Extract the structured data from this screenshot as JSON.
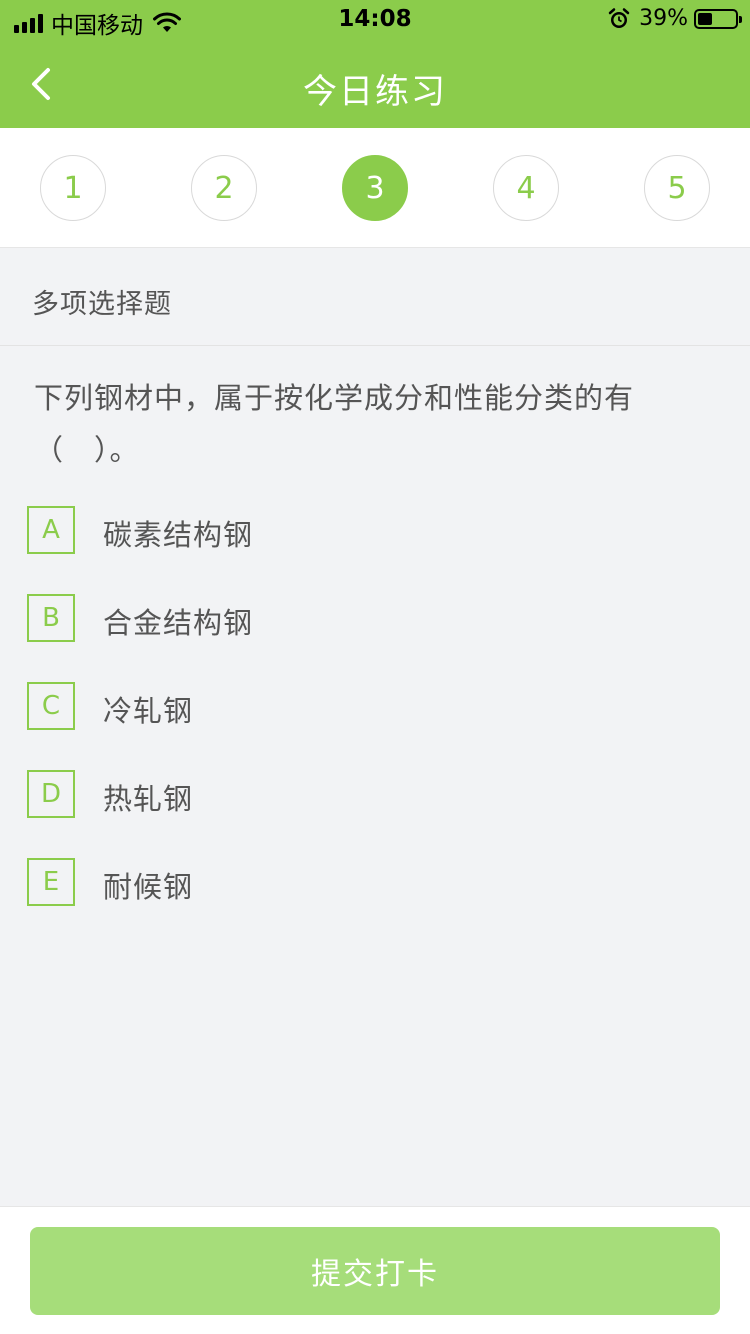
{
  "status_bar": {
    "carrier": "中国移动",
    "time": "14:08",
    "battery_percent": "39%",
    "battery_level": 0.39,
    "icons": [
      "signal-icon",
      "wifi-icon",
      "alarm-icon",
      "battery-icon"
    ]
  },
  "nav": {
    "title": "今日练习",
    "back_icon": "chevron-left-icon"
  },
  "steps": {
    "items": [
      "1",
      "2",
      "3",
      "4",
      "5"
    ],
    "active_index": 2
  },
  "question": {
    "type": "多项选择题",
    "text": "下列钢材中，属于按化学成分和性能分类的有（　）。",
    "options": [
      {
        "letter": "A",
        "text": "碳素结构钢"
      },
      {
        "letter": "B",
        "text": "合金结构钢"
      },
      {
        "letter": "C",
        "text": "冷轧钢"
      },
      {
        "letter": "D",
        "text": "热轧钢"
      },
      {
        "letter": "E",
        "text": "耐候钢"
      }
    ]
  },
  "footer": {
    "submit_label": "提交打卡"
  },
  "colors": {
    "accent": "#8bcc4b",
    "submit_disabled": "#a6dd7a",
    "background": "#f2f3f5",
    "text": "#555555"
  }
}
